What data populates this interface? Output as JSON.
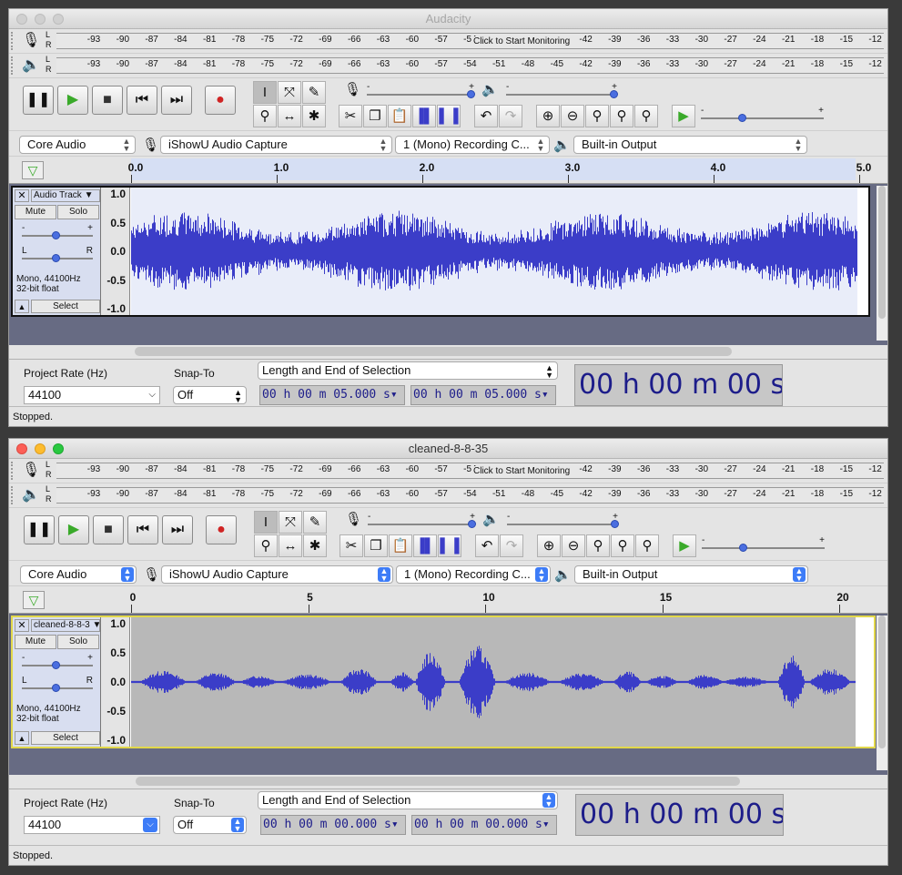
{
  "windows": [
    {
      "title": "Audacity",
      "active": false,
      "rec_meter_ticks": [
        "-93",
        "-90",
        "-87",
        "-84",
        "-81",
        "-78",
        "-75",
        "-72",
        "-69",
        "-66",
        "-63",
        "-60",
        "-57",
        "-54",
        "-42",
        "-39",
        "-36",
        "-33",
        "-30",
        "-27",
        "-24",
        "-21",
        "-18",
        "-15",
        "-12"
      ],
      "play_meter_ticks": [
        "-93",
        "-90",
        "-87",
        "-84",
        "-81",
        "-78",
        "-75",
        "-72",
        "-69",
        "-66",
        "-63",
        "-60",
        "-57",
        "-54",
        "-51",
        "-48",
        "-45",
        "-42",
        "-39",
        "-36",
        "-33",
        "-30",
        "-27",
        "-24",
        "-21",
        "-18",
        "-15",
        "-12"
      ],
      "monitor_label": "Click to Start Monitoring",
      "host": "Core Audio",
      "rec_device": "iShowU Audio Capture",
      "channels": "1 (Mono) Recording C...",
      "play_device": "Built-in Output",
      "ruler_labels": [
        "0.0",
        "1.0",
        "2.0",
        "3.0",
        "4.0",
        "5.0"
      ],
      "track": {
        "name": "Audio Track",
        "mute": "Mute",
        "solo": "Solo",
        "info1": "Mono, 44100Hz",
        "info2": "32-bit float",
        "select": "Select",
        "scale": [
          "1.0",
          "0.5",
          "0.0",
          "-0.5",
          "-1.0"
        ]
      },
      "project_rate_label": "Project Rate (Hz)",
      "project_rate": "44100",
      "snap_label": "Snap-To",
      "snap_value": "Off",
      "selection_mode": "Length and End of Selection",
      "sel_start": "00 h 00 m 05.000 s",
      "sel_end": "00 h 00 m 05.000 s",
      "big_time": "00 h 00 m 00 s",
      "status": "Stopped."
    },
    {
      "title": "cleaned-8-8-35",
      "active": true,
      "rec_meter_ticks": [
        "-93",
        "-90",
        "-87",
        "-84",
        "-81",
        "-78",
        "-75",
        "-72",
        "-69",
        "-66",
        "-63",
        "-60",
        "-57",
        "-54",
        "-42",
        "-39",
        "-36",
        "-33",
        "-30",
        "-27",
        "-24",
        "-21",
        "-18",
        "-15",
        "-12"
      ],
      "play_meter_ticks": [
        "-93",
        "-90",
        "-87",
        "-84",
        "-81",
        "-78",
        "-75",
        "-72",
        "-69",
        "-66",
        "-63",
        "-60",
        "-57",
        "-54",
        "-51",
        "-48",
        "-45",
        "-42",
        "-39",
        "-36",
        "-33",
        "-30",
        "-27",
        "-24",
        "-21",
        "-18",
        "-15",
        "-12"
      ],
      "monitor_label": "Click to Start Monitoring",
      "host": "Core Audio",
      "rec_device": "iShowU Audio Capture",
      "channels": "1 (Mono) Recording C...",
      "play_device": "Built-in Output",
      "ruler_labels": [
        "0",
        "5",
        "10",
        "15",
        "20"
      ],
      "track": {
        "name": "cleaned-8-8-3",
        "mute": "Mute",
        "solo": "Solo",
        "info1": "Mono, 44100Hz",
        "info2": "32-bit float",
        "select": "Select",
        "scale": [
          "1.0",
          "0.5",
          "0.0",
          "-0.5",
          "-1.0"
        ]
      },
      "project_rate_label": "Project Rate (Hz)",
      "project_rate": "44100",
      "snap_label": "Snap-To",
      "snap_value": "Off",
      "selection_mode": "Length and End of Selection",
      "sel_start": "00 h 00 m 00.000 s",
      "sel_end": "00 h 00 m 00.000 s",
      "big_time": "00 h 00 m 00 s",
      "status": "Stopped."
    }
  ],
  "icons": {
    "pause": "pause-icon",
    "play": "play-icon",
    "stop": "stop-icon",
    "skip_start": "skip-start-icon",
    "skip_end": "skip-end-icon",
    "record": "record-icon"
  },
  "colors": {
    "waveform": "#3b3dc8",
    "track_bg_selected": "#e9edf9",
    "track_bg": "#b8b8b8",
    "time_text": "#1d1d8a",
    "record": "#d02424",
    "play": "#3aaa2a"
  }
}
